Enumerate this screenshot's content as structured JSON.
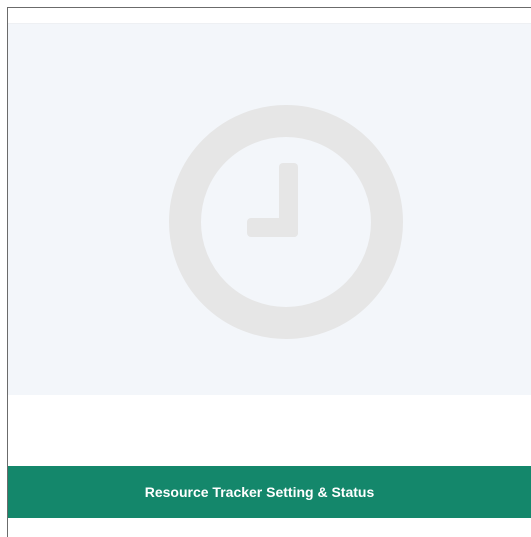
{
  "card": {
    "icon": "clock-icon",
    "icon_color": "#e6e6e6",
    "media_background": "#f3f6fa",
    "action_label": "Resource Tracker Setting & Status",
    "action_color": "#14876b"
  }
}
